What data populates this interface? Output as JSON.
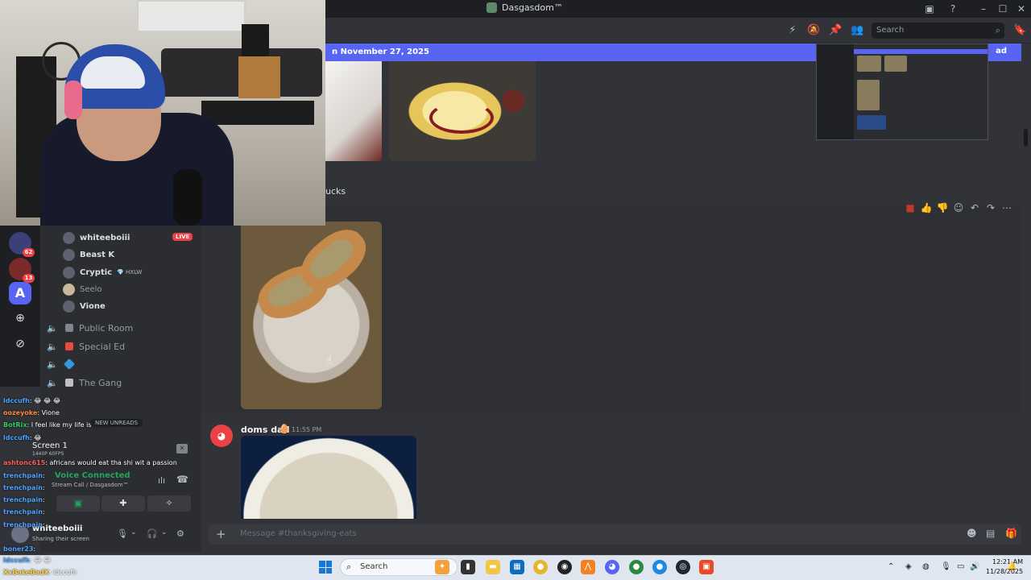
{
  "window": {
    "title": "Dasgasdom™",
    "min_icon": "minimize-icon",
    "max_icon": "maximize-icon",
    "close_icon": "close-icon"
  },
  "header": {
    "search_placeholder": "Search"
  },
  "new_messages_bar": {
    "label": "n November 27, 2025",
    "mark_label": "ad"
  },
  "messages": {
    "partial_text": "ucks",
    "author": "doms dad",
    "author_badge": "🥚",
    "time": "11:55 PM"
  },
  "voice_users": [
    {
      "name": "whiteeboiii",
      "live": "LIVE"
    },
    {
      "name": "Beast K"
    },
    {
      "name": "Cryptic",
      "tag": "💎 HXLW"
    },
    {
      "name": "Seelo"
    },
    {
      "name": "Vione"
    }
  ],
  "voice_channels": [
    {
      "name": "Public Room",
      "tag_color": "#80848e"
    },
    {
      "name": "Special Ed",
      "tag_color": "#e74c3c"
    },
    {
      "name": "",
      "tag_color": "#3498db"
    },
    {
      "name": "The Gang",
      "tag_color": "#c0c0c0"
    }
  ],
  "server_badges": [
    "62",
    "13"
  ],
  "overlay_chat": [
    {
      "name": "ldccufh",
      "msg": ": 😂 😂 😂",
      "color": "#4aa3ff"
    },
    {
      "name": "oozeyoke",
      "msg": ": Vione",
      "color": "#ff8a3d"
    },
    {
      "name": "BotRix",
      "msg": ": I feel like my life is fake...",
      "color": "#33cc66"
    },
    {
      "name": "ldccufh",
      "msg": ": 😂",
      "color": "#4aa3ff"
    },
    {
      "name": "ashtonc615",
      "msg": ": africans would eat tha shi wit a passion",
      "color": "#ff5c5c"
    },
    {
      "name": "trenchpain",
      "msg": ":",
      "color": "#4aa3ff"
    },
    {
      "name": "trenchpain",
      "msg": ":",
      "color": "#4aa3ff"
    },
    {
      "name": "trenchpain",
      "msg": ":",
      "color": "#4aa3ff"
    },
    {
      "name": "trenchpain",
      "msg": ":",
      "color": "#4aa3ff"
    },
    {
      "name": "trenchpain",
      "msg": ":",
      "color": "#4aa3ff"
    },
    {
      "name": "boner23",
      "msg": ":",
      "color": "#4aa3ff"
    },
    {
      "name": "ldccufh",
      "msg": ": 😂 😂",
      "color": "#4aa3ff"
    },
    {
      "name": "XxBakeBadX",
      "msg": ": ldccufh",
      "color": "#ffd23d"
    }
  ],
  "unreads_label": "NEW UNREADS",
  "share": {
    "title": "Screen 1",
    "fps": "1440P 60FPS",
    "voice_status": "Voice Connected",
    "voice_sub": "Stream Call / Dasgasdom™"
  },
  "user_panel": {
    "name": "whiteeboiii",
    "status": "Sharing their screen"
  },
  "composer": {
    "placeholder": "Message #thanksgiving-eats"
  },
  "taskbar": {
    "search_label": "Search",
    "time": "12:21 AM",
    "date": "11/28/2025"
  }
}
